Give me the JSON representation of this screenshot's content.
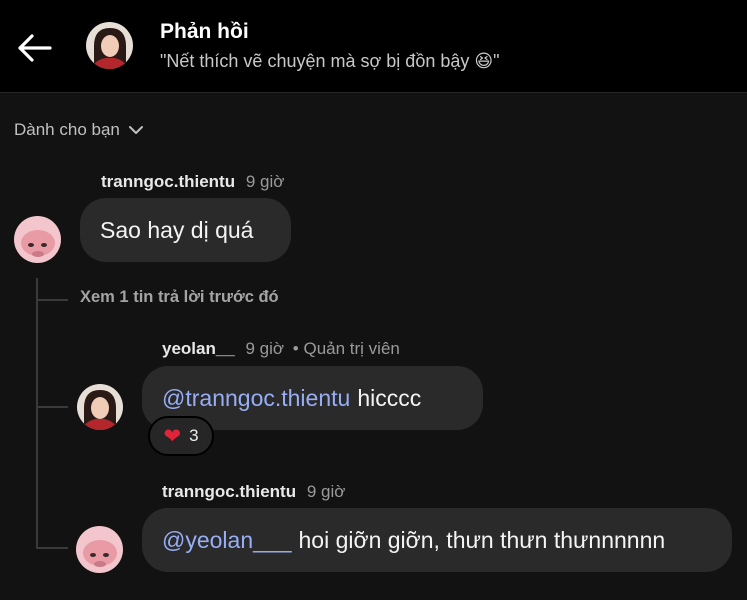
{
  "header": {
    "title": "Phản hồi",
    "subtitle": "\"Nết thích vẽ chuyện mà sợ bị đồn bậy 😆\"",
    "back_icon": "arrow-left-icon"
  },
  "sort": {
    "label": "Dành cho bạn",
    "icon": "chevron-down-icon"
  },
  "comments": [
    {
      "username": "tranngoc.thientu",
      "time": "9 giờ",
      "text": "Sao hay dị quá"
    }
  ],
  "view_previous": "Xem 1 tin trả lời trước đó",
  "replies": [
    {
      "username": "yeolan__",
      "time": "9 giờ",
      "role": "• Quản trị viên",
      "mention": "@tranngoc.thientu",
      "text": "hicccc",
      "reaction": {
        "icon": "heart-icon",
        "count": "3"
      }
    },
    {
      "username": "tranngoc.thientu",
      "time": "9 giờ",
      "mention": "@yeolan___",
      "text": "hoi giỡn giỡn, thưn thưn thưnnnnnn"
    }
  ]
}
